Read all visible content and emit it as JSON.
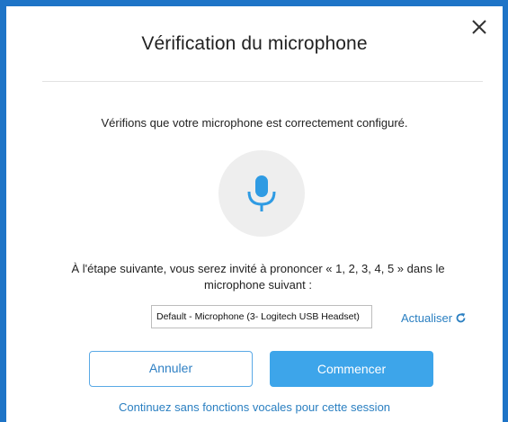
{
  "dialog": {
    "title": "Vérification du microphone",
    "intro": "Vérifions que votre microphone est correctement configuré.",
    "instruction_line1": "À l'étape suivante, vous serez invité à prononcer « 1, 2, 3, 4, 5 » dans le",
    "instruction_line2": "microphone suivant :",
    "microphone_selected": "Default - Microphone (3- Logitech USB Headset)",
    "refresh_label": "Actualiser",
    "cancel_label": "Annuler",
    "start_label": "Commencer",
    "continue_link": "Continuez sans fonctions vocales pour cette session"
  },
  "icons": {
    "close": "close-icon",
    "microphone": "microphone-icon",
    "refresh": "refresh-icon"
  },
  "colors": {
    "frame_border": "#1e74c7",
    "accent": "#3da5ea",
    "link": "#2a7fc1",
    "mic_icon": "#2f9be3",
    "mic_circle": "#eeeeee"
  }
}
